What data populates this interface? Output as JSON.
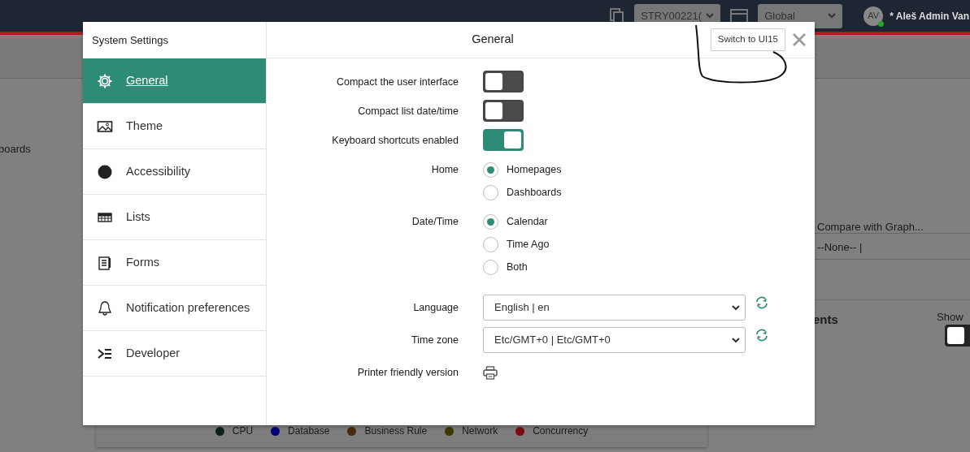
{
  "top_bar": {
    "update_set": "STRY00221(",
    "application": "Global",
    "avatar": "AV",
    "user": "* Aleš Admin Van"
  },
  "background": {
    "left_text": "boards",
    "compare_label": "Compare with Graph...",
    "compare_value": "--None-- |",
    "section_title": "ents",
    "show_label": "Show",
    "show_toggle_on": false,
    "legend": [
      {
        "label": "CPU",
        "color": "#0c2418"
      },
      {
        "label": "Database",
        "color": "#00007a"
      },
      {
        "label": "Business Rule",
        "color": "#4a2a0a"
      },
      {
        "label": "Network",
        "color": "#3a3a00"
      },
      {
        "label": "Concurrency",
        "color": "#7a0c0c"
      }
    ]
  },
  "modal": {
    "title": "System Settings",
    "heading": "General",
    "switch_button": "Switch to UI15",
    "sidebar": {
      "items": [
        {
          "label": "General",
          "selected": true
        },
        {
          "label": "Theme",
          "selected": false
        },
        {
          "label": "Accessibility",
          "selected": false
        },
        {
          "label": "Lists",
          "selected": false
        },
        {
          "label": "Forms",
          "selected": false
        },
        {
          "label": "Notification preferences",
          "selected": false
        },
        {
          "label": "Developer",
          "selected": false
        }
      ]
    },
    "settings": [
      {
        "kind": "toggle",
        "label": "Compact the user interface",
        "on": false
      },
      {
        "kind": "toggle",
        "label": "Compact list date/time",
        "on": false
      },
      {
        "kind": "toggle",
        "label": "Keyboard shortcuts enabled",
        "on": true
      },
      {
        "kind": "radio",
        "label": "Home",
        "options": [
          {
            "label": "Homepages",
            "selected": true
          },
          {
            "label": "Dashboards",
            "selected": false
          }
        ]
      },
      {
        "kind": "radio",
        "label": "Date/Time",
        "options": [
          {
            "label": "Calendar",
            "selected": true
          },
          {
            "label": "Time Ago",
            "selected": false
          },
          {
            "label": "Both",
            "selected": false
          }
        ]
      },
      {
        "kind": "select",
        "label": "Language",
        "value": "English | en"
      },
      {
        "kind": "select",
        "label": "Time zone",
        "value": "Etc/GMT+0 | Etc/GMT+0"
      },
      {
        "kind": "printer",
        "label": "Printer friendly version"
      }
    ]
  }
}
